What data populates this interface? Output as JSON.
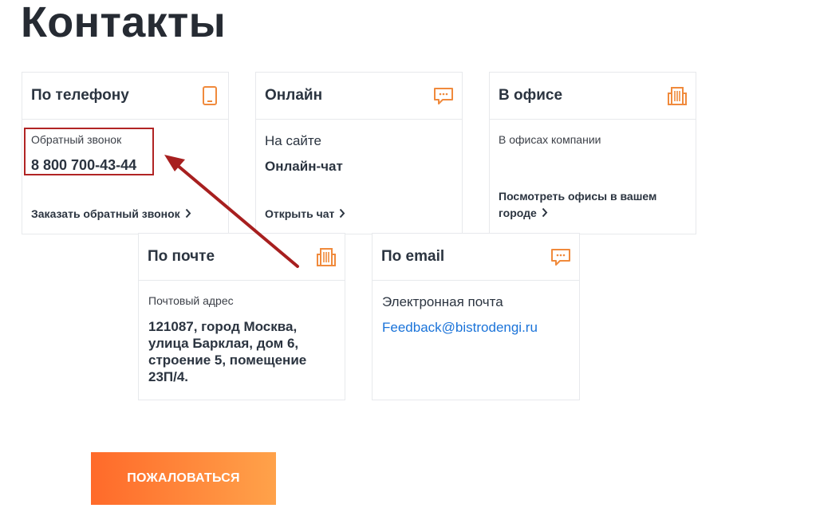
{
  "page": {
    "title": "Контакты"
  },
  "colors": {
    "accent": "#f08a3c",
    "link": "#1a73d9",
    "highlight": "#b12424",
    "button_start": "#ff6a2a",
    "button_end": "#ffa24a"
  },
  "cards": {
    "phone": {
      "title": "По телефону",
      "icon": "phone-icon",
      "label": "Обратный звонок",
      "number": "8 800 700-43-44",
      "action": "Заказать обратный звонок"
    },
    "online": {
      "title": "Онлайн",
      "icon": "chat-bubble-icon",
      "label": "На сайте",
      "value": "Онлайн-чат",
      "action": "Открыть чат"
    },
    "office": {
      "title": "В офисе",
      "icon": "building-icon",
      "label": "В офисах компании",
      "action_line1": "Посмотреть офисы в вашем",
      "action_line2": "городе"
    },
    "mail": {
      "title": "По почте",
      "icon": "building-icon",
      "label": "Почтовый адрес",
      "address_lines": [
        "121087, город Москва,",
        "улица Барклая, дом 6,",
        "строение 5, помещение",
        "23П/4."
      ]
    },
    "email": {
      "title": "По email",
      "icon": "chat-bubble-icon",
      "label": "Электронная почта",
      "address": "Feedback@bistrodengi.ru"
    }
  },
  "complain_button": {
    "label": "ПОЖАЛОВАТЬСЯ"
  }
}
